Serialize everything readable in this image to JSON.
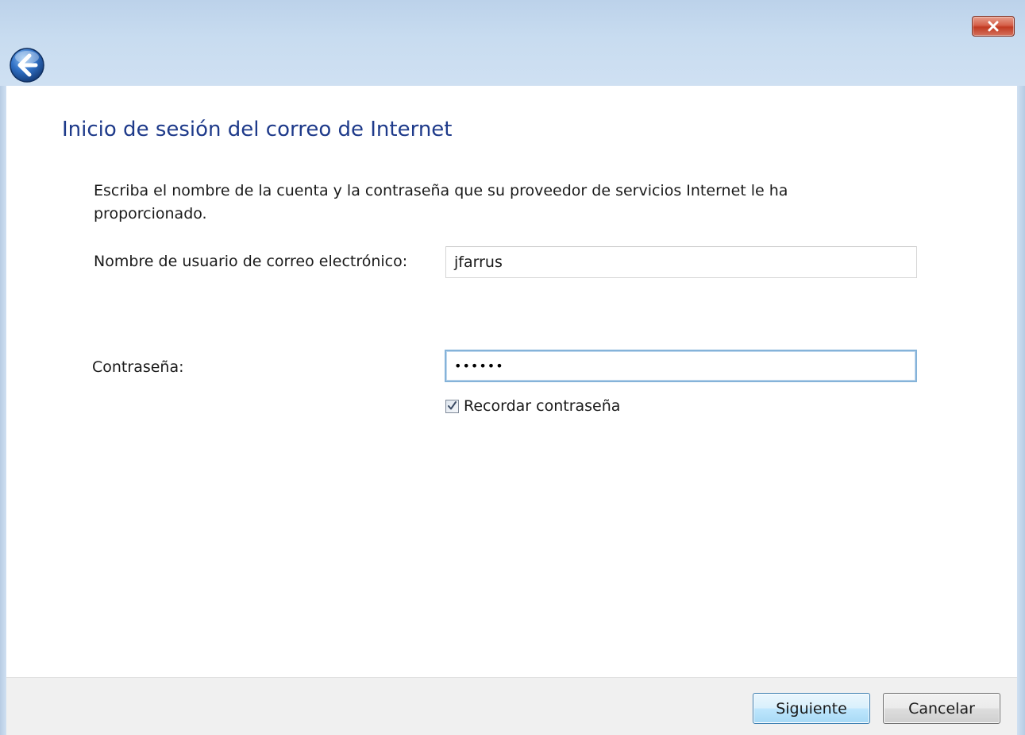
{
  "window": {
    "close_icon": "close-x-icon",
    "back_icon": "back-arrow-icon"
  },
  "wizard": {
    "heading": "Inicio de sesión del correo de Internet",
    "description": "Escriba el nombre de la cuenta y la contraseña que su proveedor de servicios Internet le ha proporcionado.",
    "username": {
      "label": "Nombre de usuario de correo electrónico:",
      "value": "jfarrus"
    },
    "password": {
      "label": "Contraseña:",
      "value_masked": "••••••"
    },
    "remember_password": {
      "label": "Recordar contraseña",
      "checked": true
    }
  },
  "footer": {
    "next_label": "Siguiente",
    "cancel_label": "Cancelar"
  },
  "colors": {
    "heading": "#1e3a8a",
    "frame": "#c5d9ee",
    "close_button": "#c13a22",
    "back_button": "#2f6fc4"
  }
}
